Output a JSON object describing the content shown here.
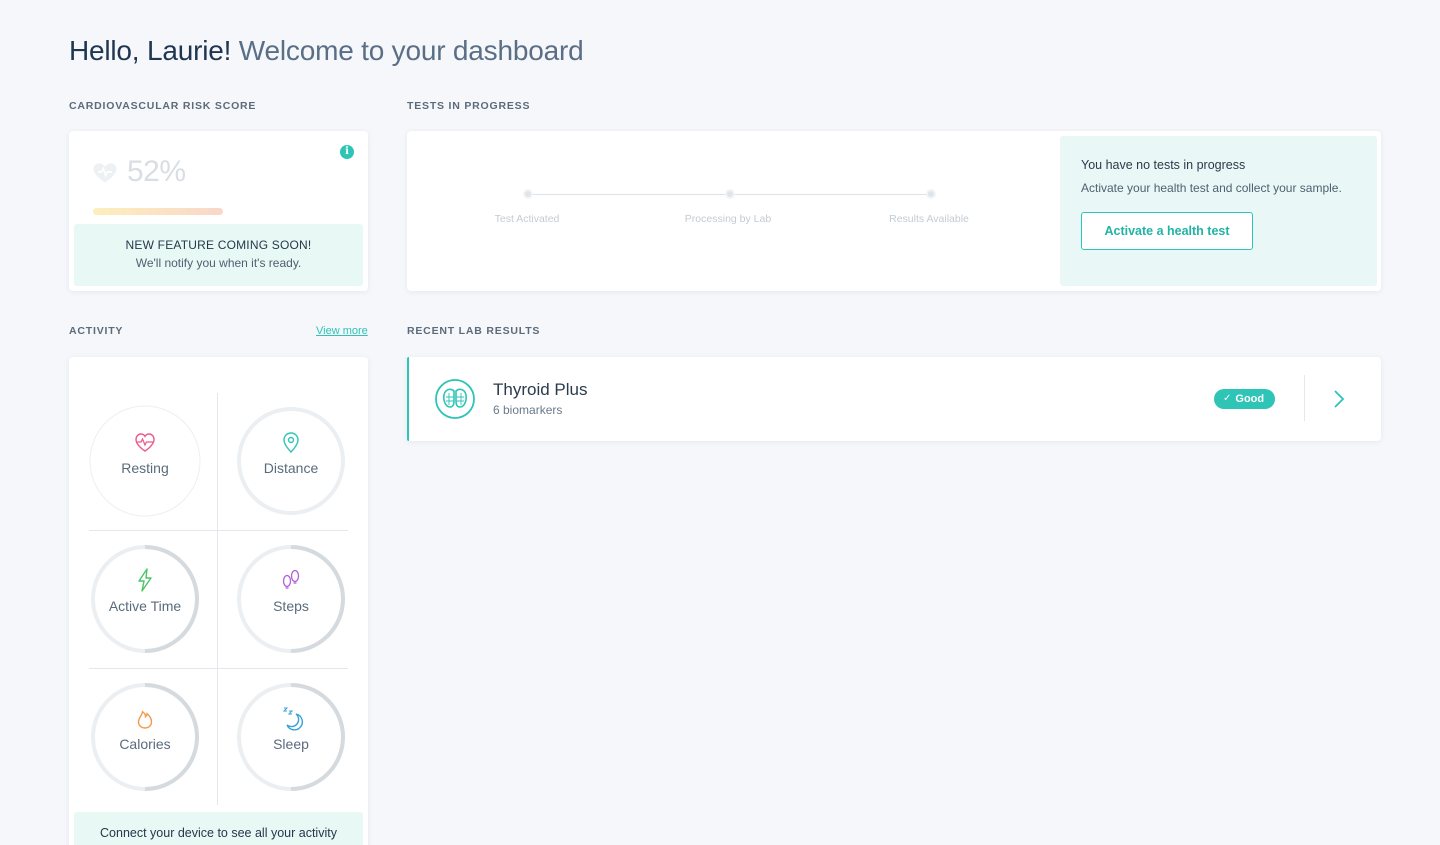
{
  "greeting": {
    "name": "Hello, Laurie!",
    "welcome": "Welcome to your dashboard"
  },
  "cardio": {
    "label": "CARDIOVASCULAR RISK SCORE",
    "score": "52%",
    "notice_title": "NEW FEATURE COMING SOON!",
    "notice_sub": "We'll notify you when it's ready.",
    "info_icon": "info-icon"
  },
  "tests": {
    "label": "TESTS IN PROGRESS",
    "steps": [
      "Test Activated",
      "Processing by Lab",
      "Results Available"
    ],
    "empty_title": "You have no tests in progress",
    "empty_sub": "Activate your health test and collect your sample.",
    "activate_button": "Activate a health test"
  },
  "activity": {
    "label": "ACTIVITY",
    "view_more": "View more",
    "metrics": [
      {
        "label": "Resting",
        "icon": "heart-rate-icon",
        "color": "#ec5a8a"
      },
      {
        "label": "Distance",
        "icon": "location-pin-icon",
        "color": "#2ec4b6"
      },
      {
        "label": "Active Time",
        "icon": "lightning-icon",
        "color": "#4cc46a"
      },
      {
        "label": "Steps",
        "icon": "footsteps-icon",
        "color": "#b061d6"
      },
      {
        "label": "Calories",
        "icon": "flame-icon",
        "color": "#f39a4a"
      },
      {
        "label": "Sleep",
        "icon": "moon-zzz-icon",
        "color": "#3aa0d8"
      }
    ],
    "footer": "Connect your device to see all your activity"
  },
  "lab": {
    "label": "RECENT LAB RESULTS",
    "title": "Thyroid Plus",
    "sub": "6 biomarkers",
    "badge": "Good",
    "icon": "thyroid-icon"
  },
  "colors": {
    "accent": "#2ec4b6",
    "background": "#f5f7fb"
  }
}
